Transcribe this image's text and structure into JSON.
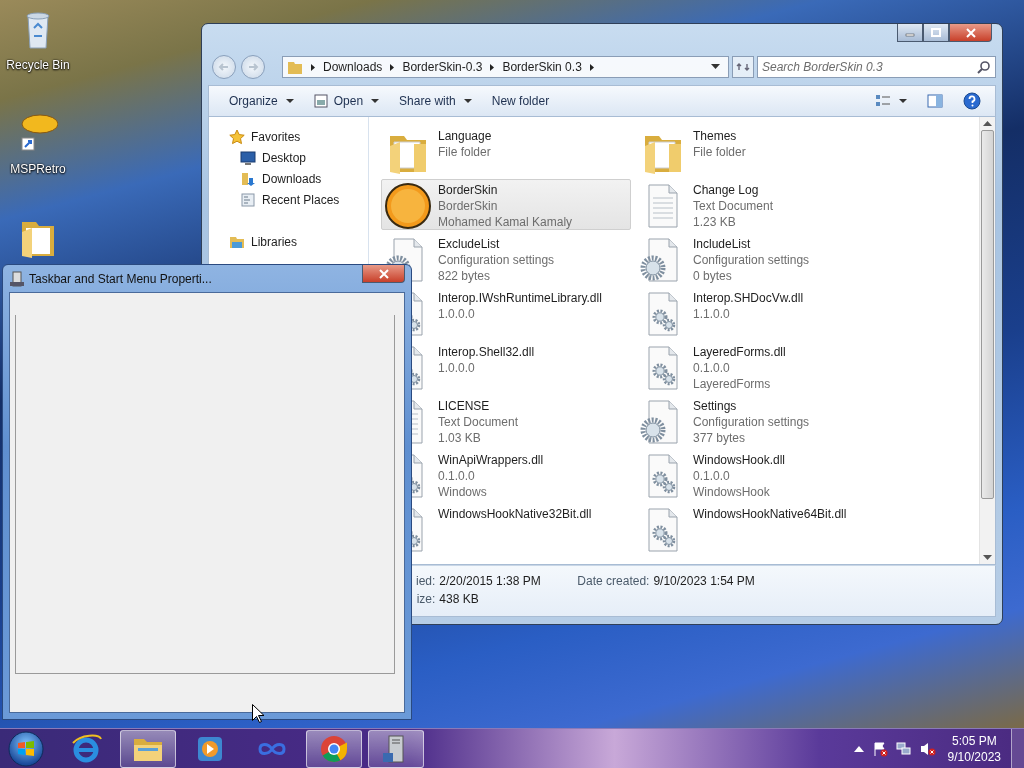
{
  "desktop_icons": [
    {
      "kind": "recycle-bin",
      "label": "Recycle Bin"
    },
    {
      "kind": "shortcut",
      "label": "MSPRetro"
    },
    {
      "kind": "folder"
    }
  ],
  "explorer": {
    "breadcrumb": [
      "Downloads",
      "BorderSkin-0.3",
      "BorderSkin 0.3"
    ],
    "search": {
      "placeholder": "Search BorderSkin 0.3"
    },
    "toolbar": [
      {
        "label": "Organize",
        "kind": "menu",
        "dropdown": true
      },
      {
        "label": "Open",
        "kind": "open",
        "dropdown": true
      },
      {
        "label": "Share with",
        "kind": "menu",
        "dropdown": true
      },
      {
        "label": "New folder",
        "kind": "menu",
        "dropdown": false
      }
    ],
    "sidebar": [
      {
        "label": "Favorites",
        "kind": "star",
        "children": [
          {
            "label": "Desktop",
            "kind": "desktop"
          },
          {
            "label": "Downloads",
            "kind": "downloads"
          },
          {
            "label": "Recent Places",
            "kind": "recent"
          }
        ]
      },
      {
        "label": "Libraries",
        "kind": "libraries"
      }
    ],
    "files": [
      {
        "name": "Language",
        "lines": [
          "File folder"
        ],
        "kind": "folder",
        "selected": false
      },
      {
        "name": "Themes",
        "lines": [
          "File folder"
        ],
        "kind": "folder",
        "selected": false
      },
      {
        "name": "BorderSkin",
        "lines": [
          "BorderSkin",
          "Mohamed Kamal Kamaly"
        ],
        "kind": "app",
        "selected": true
      },
      {
        "name": "Change Log",
        "lines": [
          "Text Document",
          "1.23 KB"
        ],
        "kind": "text",
        "selected": false
      },
      {
        "name": "ExcludeList",
        "lines": [
          "Configuration settings",
          "822 bytes"
        ],
        "kind": "config",
        "selected": false
      },
      {
        "name": "IncludeList",
        "lines": [
          "Configuration settings",
          "0 bytes"
        ],
        "kind": "config",
        "selected": false
      },
      {
        "name": "Interop.IWshRuntimeLibrary.dll",
        "lines": [
          "1.0.0.0"
        ],
        "kind": "dll",
        "selected": false
      },
      {
        "name": "Interop.SHDocVw.dll",
        "lines": [
          "1.1.0.0"
        ],
        "kind": "dll",
        "selected": false
      },
      {
        "name": "Interop.Shell32.dll",
        "lines": [
          "1.0.0.0"
        ],
        "kind": "dll",
        "selected": false
      },
      {
        "name": "LayeredForms.dll",
        "lines": [
          "0.1.0.0",
          "LayeredForms"
        ],
        "kind": "dll",
        "selected": false
      },
      {
        "name": "LICENSE",
        "lines": [
          "Text Document",
          "1.03 KB"
        ],
        "kind": "text",
        "selected": false
      },
      {
        "name": "Settings",
        "lines": [
          "Configuration settings",
          "377 bytes"
        ],
        "kind": "config",
        "selected": false
      },
      {
        "name": "WinApiWrappers.dll",
        "lines": [
          "0.1.0.0",
          "Windows"
        ],
        "kind": "dll",
        "selected": false
      },
      {
        "name": "WindowsHook.dll",
        "lines": [
          "0.1.0.0",
          "WindowsHook"
        ],
        "kind": "dll",
        "selected": false
      },
      {
        "name": "WindowsHookNative32Bit.dll",
        "kind": "dll",
        "selected": false
      },
      {
        "name": "WindowsHookNative64Bit.dll",
        "kind": "dll",
        "selected": false
      }
    ],
    "details": [
      {
        "label": "ied:",
        "value": "2/20/2015 1:38 PM"
      },
      {
        "label": "Date created:",
        "value": "9/10/2023 1:54 PM"
      },
      {
        "label": "ize:",
        "value": "438 KB"
      }
    ]
  },
  "dialog": {
    "title": "Taskbar and Start Menu Properti..."
  },
  "taskbar": {
    "apps": [
      {
        "kind": "ie",
        "active": false
      },
      {
        "kind": "explorer",
        "active": true
      },
      {
        "kind": "media",
        "active": false
      },
      {
        "kind": "infinity",
        "active": false
      },
      {
        "kind": "chrome",
        "active": true
      },
      {
        "kind": "server",
        "active": true
      }
    ],
    "clock": {
      "time": "5:05 PM",
      "date": "9/10/2023"
    }
  }
}
